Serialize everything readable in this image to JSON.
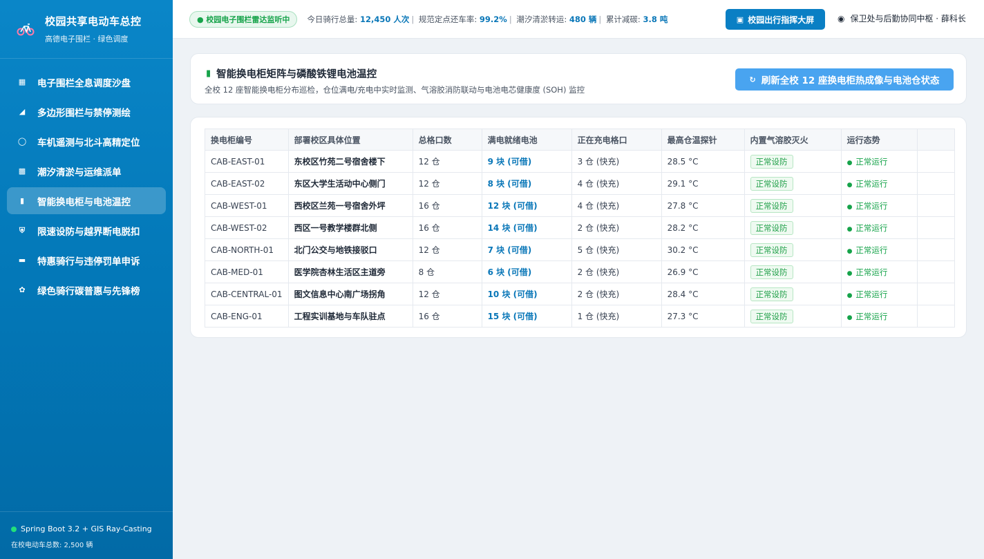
{
  "sidebar": {
    "brand_title": "校园共享电动车总控",
    "brand_sub": "高德电子围栏 · 绿色调度",
    "items": [
      {
        "label": "电子围栏全息调度沙盘",
        "icon": "map-icon"
      },
      {
        "label": "多边形围栏与禁停测绘",
        "icon": "triangle-ruler-icon"
      },
      {
        "label": "车机遥测与北斗高精定位",
        "icon": "bicycle-icon"
      },
      {
        "label": "潮汐清淤与运维派单",
        "icon": "truck-icon"
      },
      {
        "label": "智能换电柜与电池温控",
        "icon": "battery-icon"
      },
      {
        "label": "限速设防与越界断电脱扣",
        "icon": "shield-icon"
      },
      {
        "label": "特惠骑行与违停罚单申诉",
        "icon": "card-icon"
      },
      {
        "label": "绿色骑行碳普惠与先锋榜",
        "icon": "seedling-icon"
      }
    ],
    "active_index": 4,
    "footer_tech": "Spring Boot 3.2 + GIS Ray-Casting",
    "footer_count": "在校电动车总数: 2,500 辆"
  },
  "topbar": {
    "radar_badge": "● 校园电子围栏雷达监听中",
    "stat1_label": "今日骑行总量:",
    "stat1_value": "12,450 人次",
    "stat2_label": "规范定点还车率:",
    "stat2_value": "99.2%",
    "stat3_label": "潮汐清淤转运:",
    "stat3_value": "480 辆",
    "stat4_label": "累计减碳:",
    "stat4_value": "3.8 吨",
    "screen_button": "校园出行指挥大屏",
    "user": "保卫处与后勤协同中枢 · 薛科长"
  },
  "header": {
    "title": "智能换电柜矩阵与磷酸铁锂电池温控",
    "desc": "全校 12 座智能换电柜分布巡检，仓位满电/充电中实时监测、气溶胶消防联动与电池电芯健康度 (SOH) 监控",
    "refresh_button": "刷新全校 12 座换电柜热成像与电池仓状态"
  },
  "table": {
    "columns": [
      "换电柜编号",
      "部署校区具体位置",
      "总格口数",
      "满电就绪电池",
      "正在充电格口",
      "最高仓温探针",
      "内置气溶胶灭火",
      "运行态势"
    ],
    "rows": [
      {
        "id": "CAB-EAST-01",
        "location": "东校区竹苑二号宿舍楼下",
        "slots": "12 仓",
        "ready": "9 块 (可借)",
        "charging": "3 仓 (快充)",
        "temp": "28.5 °C",
        "fire": "正常设防",
        "status": "正常运行"
      },
      {
        "id": "CAB-EAST-02",
        "location": "东区大学生活动中心侧门",
        "slots": "12 仓",
        "ready": "8 块 (可借)",
        "charging": "4 仓 (快充)",
        "temp": "29.1 °C",
        "fire": "正常设防",
        "status": "正常运行"
      },
      {
        "id": "CAB-WEST-01",
        "location": "西校区兰苑一号宿舍外坪",
        "slots": "16 仓",
        "ready": "12 块 (可借)",
        "charging": "4 仓 (快充)",
        "temp": "27.8 °C",
        "fire": "正常设防",
        "status": "正常运行"
      },
      {
        "id": "CAB-WEST-02",
        "location": "西区一号教学楼群北侧",
        "slots": "16 仓",
        "ready": "14 块 (可借)",
        "charging": "2 仓 (快充)",
        "temp": "28.2 °C",
        "fire": "正常设防",
        "status": "正常运行"
      },
      {
        "id": "CAB-NORTH-01",
        "location": "北门公交与地铁接驳口",
        "slots": "12 仓",
        "ready": "7 块 (可借)",
        "charging": "5 仓 (快充)",
        "temp": "30.2 °C",
        "fire": "正常设防",
        "status": "正常运行"
      },
      {
        "id": "CAB-MED-01",
        "location": "医学院杏林生活区主道旁",
        "slots": "8 仓",
        "ready": "6 块 (可借)",
        "charging": "2 仓 (快充)",
        "temp": "26.9 °C",
        "fire": "正常设防",
        "status": "正常运行"
      },
      {
        "id": "CAB-CENTRAL-01",
        "location": "图文信息中心南广场拐角",
        "slots": "12 仓",
        "ready": "10 块 (可借)",
        "charging": "2 仓 (快充)",
        "temp": "28.4 °C",
        "fire": "正常设防",
        "status": "正常运行"
      },
      {
        "id": "CAB-ENG-01",
        "location": "工程实训基地与车队驻点",
        "slots": "16 仓",
        "ready": "15 块 (可借)",
        "charging": "1 仓 (快充)",
        "temp": "27.3 °C",
        "fire": "正常设防",
        "status": "正常运行"
      }
    ]
  }
}
